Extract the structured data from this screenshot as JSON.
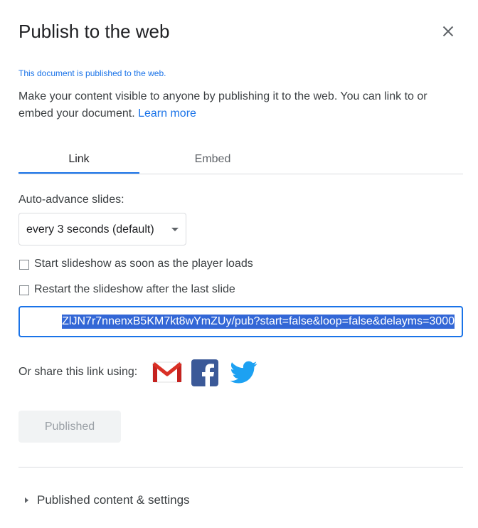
{
  "dialog": {
    "title": "Publish to the web",
    "close_icon": "close-icon"
  },
  "status": "This document is published to the web.",
  "description": {
    "text": "Make your content visible to anyone by publishing it to the web. You can link to or embed your document.",
    "learn_more": "Learn more"
  },
  "tabs": [
    {
      "label": "Link",
      "active": true
    },
    {
      "label": "Embed",
      "active": false
    }
  ],
  "auto_advance": {
    "label": "Auto-advance slides:",
    "selected": "every 3 seconds (default)"
  },
  "checkboxes": [
    {
      "label": "Start slideshow as soon as the player loads",
      "checked": false
    },
    {
      "label": "Restart the slideshow after the last slide",
      "checked": false
    }
  ],
  "link_field": {
    "value": "ZlJN7r7nnenxB5KM7kt8wYmZUy/pub?start=false&loop=false&delayms=3000"
  },
  "share": {
    "label": "Or share this link using:",
    "icons": [
      "gmail-icon",
      "facebook-icon",
      "twitter-icon"
    ]
  },
  "publish_button": {
    "label": "Published",
    "disabled": true
  },
  "settings_section": {
    "label": "Published content & settings",
    "expanded": false
  },
  "colors": {
    "accent": "#1a73e8",
    "selection": "#3367d6",
    "gmail_red": "#d93025",
    "facebook_blue": "#3b5998",
    "twitter_blue": "#1da1f2"
  }
}
